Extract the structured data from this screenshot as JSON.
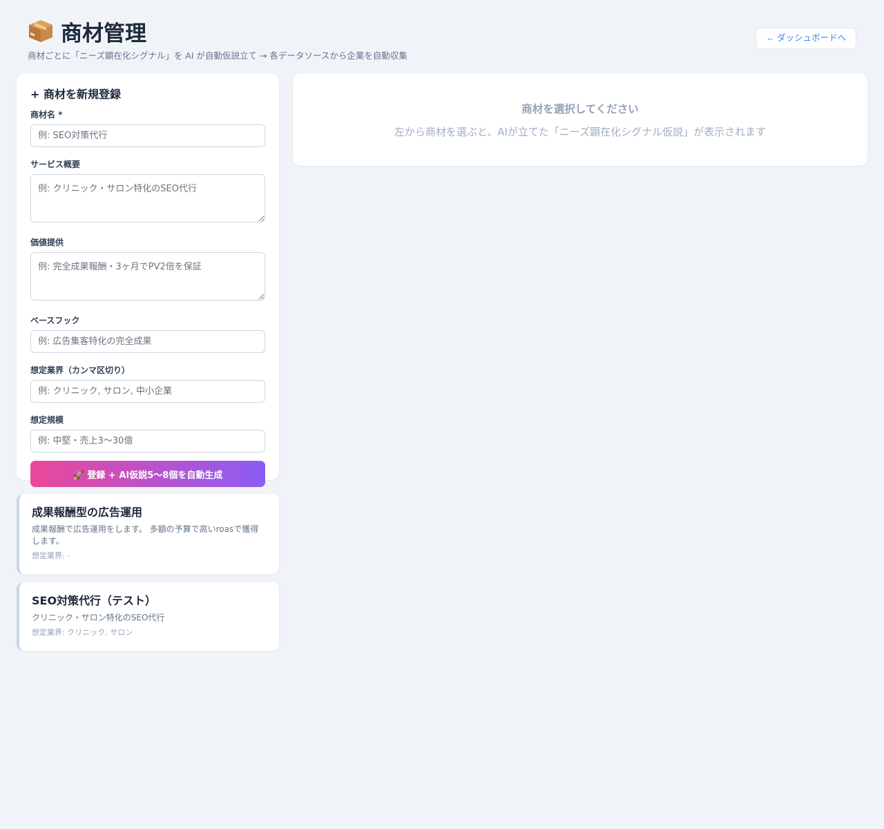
{
  "header": {
    "title": "商材管理",
    "title_icon": "package-icon",
    "subtitle": "商材ごとに「ニーズ顕在化シグナル」を AI が自動仮説立て → 各データソースから企業を自動収集",
    "back_label": "← ダッシュボードへ"
  },
  "form": {
    "title": "+ 商材を新規登録",
    "name_label": "商材名 *",
    "name_placeholder": "例: SEO対策代行",
    "overview_label": "サービス概要",
    "overview_placeholder": "例: クリニック・サロン特化のSEO代行",
    "value_label": "価値提供",
    "value_placeholder": "例: 完全成果報酬・3ヶ月でPV2倍を保証",
    "hook_label": "ベースフック",
    "hook_placeholder": "例: 広告集客特化の完全成果",
    "industry_label": "想定業界（カンマ区切り）",
    "industry_placeholder": "例: クリニック, サロン, 中小企業",
    "scale_label": "想定規模",
    "scale_placeholder": "例: 中堅・売上3〜30億",
    "submit_label": "🚀 登録 + AI仮説5〜8個を自動生成"
  },
  "products": [
    {
      "name": "成果報酬型の広告運用",
      "description": "成果報酬で広告運用をします。 多額の予算で高いroasで獲得します。",
      "industry": "想定業界: -"
    },
    {
      "name": "SEO対策代行（テスト）",
      "description": "クリニック・サロン特化のSEO代行",
      "industry": "想定業界: クリニック, サロン"
    }
  ],
  "detail": {
    "empty_title": "商材を選択してください",
    "empty_description": "左から商材を選ぶと、AIが立てた「ニーズ顕在化シグナル仮説」が表示されます"
  },
  "colors": {
    "background": "#f0f4f9",
    "accent": "#3b82f6",
    "gradient_start": "#ec4899",
    "gradient_end": "#8b5cf6"
  }
}
